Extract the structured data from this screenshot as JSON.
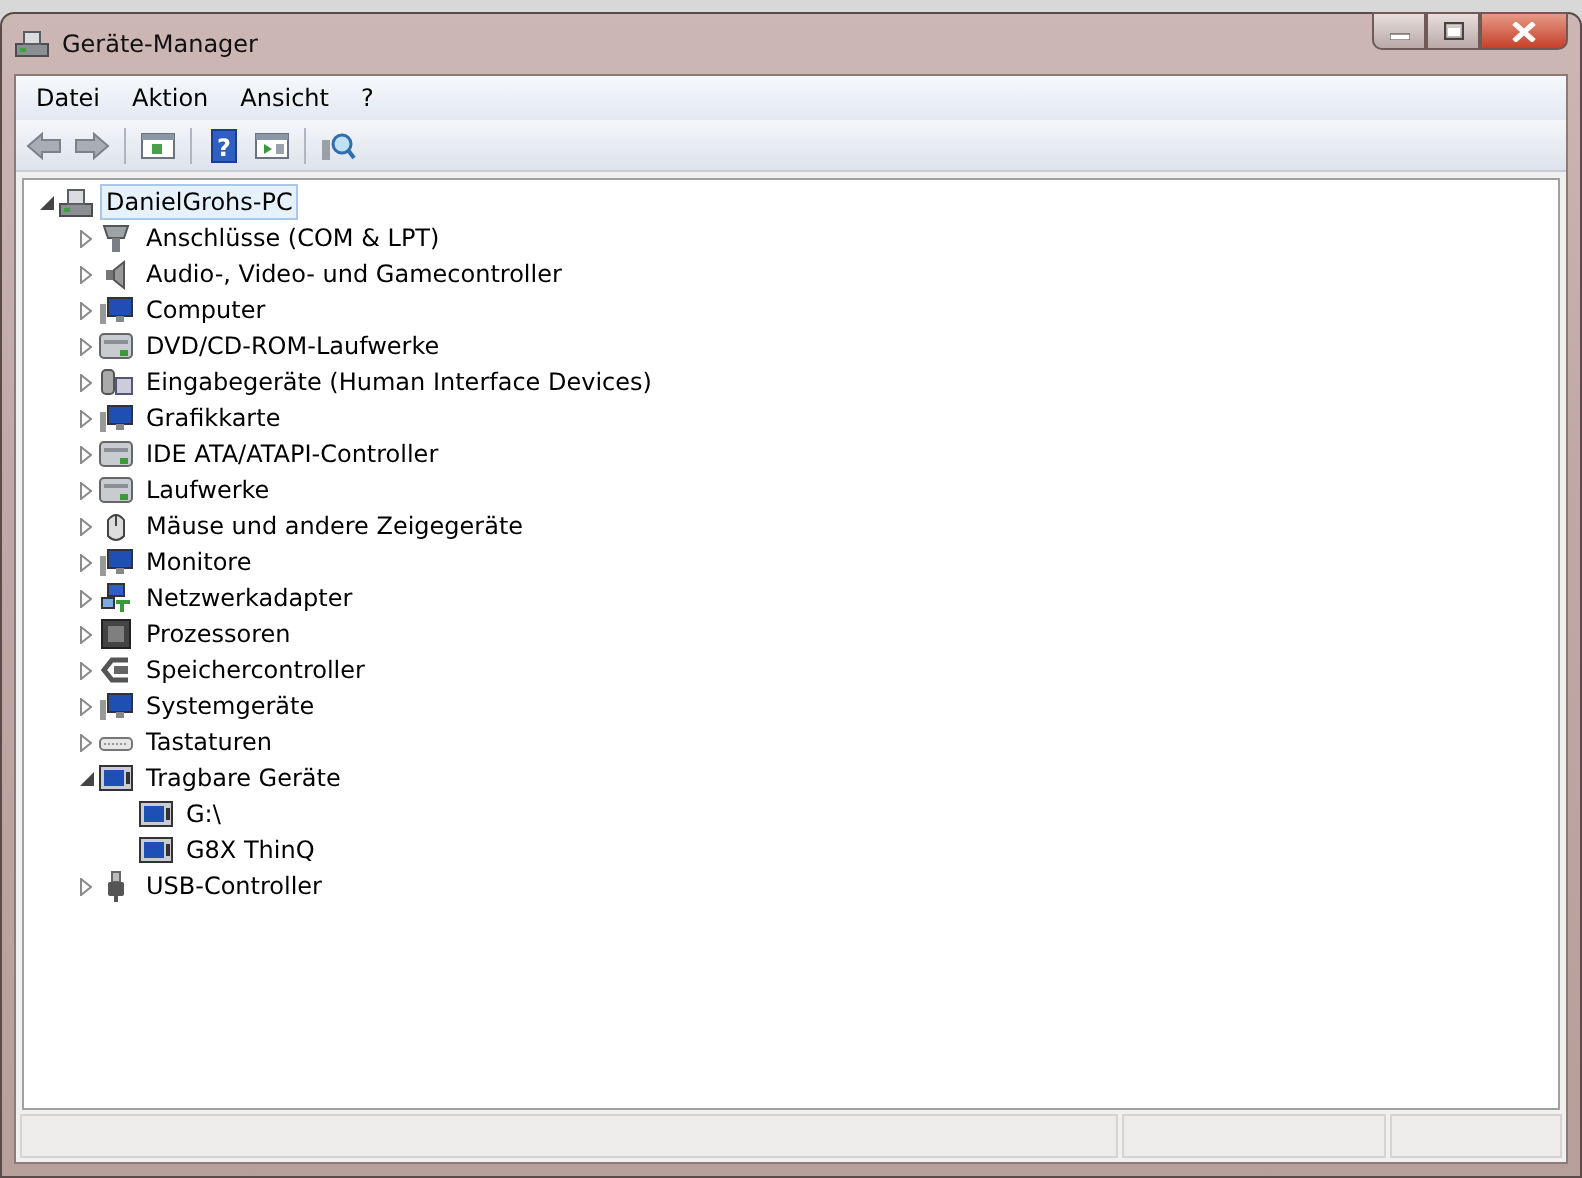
{
  "window": {
    "title": "Geräte-Manager"
  },
  "menu": [
    {
      "label": "Datei"
    },
    {
      "label": "Aktion"
    },
    {
      "label": "Ansicht"
    },
    {
      "label": "?"
    }
  ],
  "toolbar": [
    {
      "kind": "back"
    },
    {
      "kind": "forward"
    },
    {
      "kind": "separator"
    },
    {
      "kind": "console"
    },
    {
      "kind": "separator"
    },
    {
      "kind": "help",
      "glyph": "?"
    },
    {
      "kind": "panel"
    },
    {
      "kind": "separator"
    },
    {
      "kind": "scan"
    }
  ],
  "tree": [
    {
      "label": "DanielGrohs-PC",
      "kind": "computer",
      "expanded": true,
      "selected": true,
      "children": [
        {
          "label": "Anschlüsse (COM & LPT)",
          "kind": "port",
          "expanded": false,
          "selected": false
        },
        {
          "label": "Audio-, Video- und Gamecontroller",
          "kind": "speaker",
          "expanded": false,
          "selected": false
        },
        {
          "label": "Computer",
          "kind": "monitor",
          "expanded": false,
          "selected": false
        },
        {
          "label": "DVD/CD-ROM-Laufwerke",
          "kind": "drive",
          "expanded": false,
          "selected": false
        },
        {
          "label": "Eingabegeräte (Human Interface Devices)",
          "kind": "input",
          "expanded": false,
          "selected": false
        },
        {
          "label": "Grafikkarte",
          "kind": "monitor",
          "expanded": false,
          "selected": false
        },
        {
          "label": "IDE ATA/ATAPI-Controller",
          "kind": "drive",
          "expanded": false,
          "selected": false
        },
        {
          "label": "Laufwerke",
          "kind": "drive",
          "expanded": false,
          "selected": false
        },
        {
          "label": "Mäuse und andere Zeigegeräte",
          "kind": "mouse",
          "expanded": false,
          "selected": false
        },
        {
          "label": "Monitore",
          "kind": "monitor",
          "expanded": false,
          "selected": false
        },
        {
          "label": "Netzwerkadapter",
          "kind": "network",
          "expanded": false,
          "selected": false
        },
        {
          "label": "Prozessoren",
          "kind": "chip",
          "expanded": false,
          "selected": false
        },
        {
          "label": "Speichercontroller",
          "kind": "memory",
          "expanded": false,
          "selected": false
        },
        {
          "label": "Systemgeräte",
          "kind": "monitor",
          "expanded": false,
          "selected": false
        },
        {
          "label": "Tastaturen",
          "kind": "keyboard",
          "expanded": false,
          "selected": false
        },
        {
          "label": "Tragbare Geräte",
          "kind": "portable",
          "expanded": true,
          "selected": false,
          "children": [
            {
              "label": "G:\\",
              "kind": "portable",
              "selected": false
            },
            {
              "label": "G8X ThinQ",
              "kind": "portable",
              "selected": false
            }
          ]
        },
        {
          "label": "USB-Controller",
          "kind": "usb",
          "expanded": false,
          "selected": false
        }
      ]
    }
  ]
}
